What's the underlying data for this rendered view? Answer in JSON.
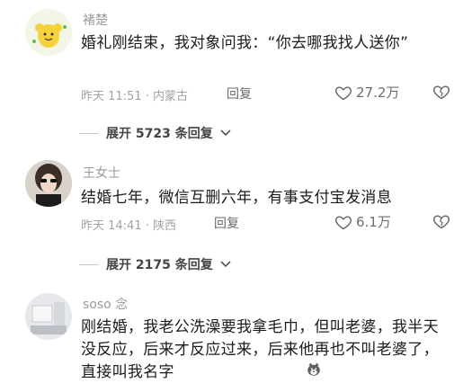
{
  "comments": [
    {
      "username": "褚楚",
      "text": "婚礼刚结束，我对象问我：“你去哪我找人送你”",
      "time": "昨天 11:51",
      "location": "内蒙古",
      "reply_label": "回复",
      "likes": "27.2万",
      "expand_label": "展开 5723 条回复"
    },
    {
      "username": "王女士",
      "text": "结婚七年，微信互删六年，有事支付宝发消息",
      "time": "昨天 14:41",
      "location": "陕西",
      "reply_label": "回复",
      "likes": "6.1万",
      "expand_label": "展开 2175 条回复"
    },
    {
      "username": "soso 念",
      "text": "刚结婚，我老公洗澡要我拿毛巾，但叫老婆，我半天没反应，后来才反应过来，后来他再也不叫老婆了，直接叫我名字"
    }
  ],
  "colors": {
    "text": "#1c1c1c",
    "meta": "#a3a3a3",
    "username": "#9a9a9a"
  }
}
